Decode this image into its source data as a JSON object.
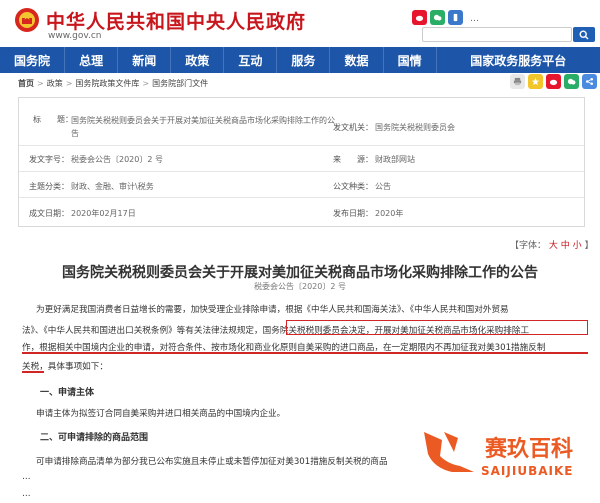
{
  "header": {
    "site_title": "中华人民共和国中央人民政府",
    "site_url": "www.gov.cn",
    "links": "…",
    "search_placeholder": ""
  },
  "nav": {
    "items": [
      {
        "label": "国务院"
      },
      {
        "label": "总理"
      },
      {
        "label": "新闻"
      },
      {
        "label": "政策"
      },
      {
        "label": "互动"
      },
      {
        "label": "服务"
      },
      {
        "label": "数据"
      },
      {
        "label": "国情"
      },
      {
        "label": "国家政务服务平台"
      }
    ]
  },
  "breadcrumb": {
    "home": "首页",
    "policy": "政策",
    "library": "国务院政策文件库",
    "dept": "国务院部门文件"
  },
  "info_table": {
    "title_label": "标　　题：",
    "title_value": "国务院关税税则委员会关于开展对美加征关税商品市场化采购排除工作的公告",
    "issuer_label": "发文机关：",
    "issuer_value": "国务院关税税则委员会",
    "docno_label": "发文字号：",
    "docno_value": "税委会公告〔2020〕2 号",
    "source_label": "来　　源：",
    "source_value": "财政部网站",
    "category_label": "主题分类：",
    "category_value": "财政、金融、审计\\税务",
    "type_label": "公文种类：",
    "type_value": "公告",
    "date_label": "成文日期：",
    "date_value": "2020年02月17日",
    "pubdate_label": "发布日期：",
    "pubdate_value": "2020年"
  },
  "font_switch": {
    "label": "【字体：",
    "large": "大",
    "medium": "中",
    "small": "小",
    "close": "】"
  },
  "article": {
    "title": "国务院关税税则委员会关于开展对美加征关税商品市场化采购排除工作的公告",
    "docno": "税委会公告〔2020〕2 号",
    "para1_line1": "为更好满足我国消费者日益增长的需要，加快受理企业排除申请，根据《中华人民共和国海关法》、《中华人民共和国对外贸易",
    "para1_line2a": "法》、《中华人民共和国进出口关税条例》等有关法律法规规定，",
    "para1_line2b": "国务院关税税则委员会决定，开展对美加征关税商品市场化采购排除工",
    "para1_line3": "作，根据相关中国境内企业的申请，对符合条件、按市场化和商业化原则自美采购的进口商品，在一定期限内不再加征我对美301措施反制",
    "para1_line4a": "关税",
    "para1_line4b": "，具体事项如下：",
    "section1": "一、申请主体",
    "section1_text": "申请主体为拟签订合同自美采购并进口相关商品的中国境内企业。",
    "section2": "二、可申请排除的商品范围",
    "para3_line1": "可申请排除商品清单为部分我已公布实施且未停止或未暂停加征对美301措施反制关税的商品",
    "para3_line2": "…",
    "para3_line3": "…"
  },
  "watermark": {
    "text": "赛玖百科",
    "sub": "SAIJIUBAIKE"
  },
  "colors": {
    "brand_red": "#c8161d",
    "nav_blue": "#1d56a8",
    "highlight_red": "#d02626",
    "watermark_orange": "#ec5a23"
  }
}
